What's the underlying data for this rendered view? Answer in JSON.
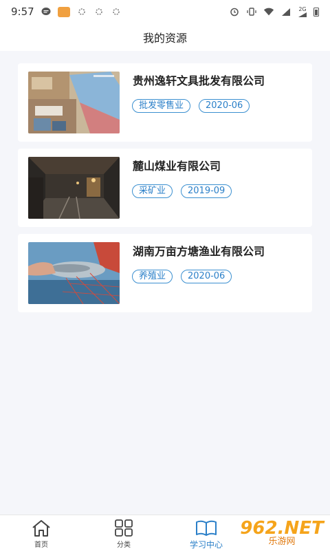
{
  "status_bar": {
    "time": "9:57",
    "network_label": "2G"
  },
  "header": {
    "title": "我的资源"
  },
  "resources": [
    {
      "company": "贵州逸轩文具批发有限公司",
      "tags": [
        "批发零售业",
        "2020-06"
      ]
    },
    {
      "company": "麓山煤业有限公司",
      "tags": [
        "采矿业",
        "2019-09"
      ]
    },
    {
      "company": "湖南万亩方塘渔业有限公司",
      "tags": [
        "养殖业",
        "2020-06"
      ]
    }
  ],
  "bottom_nav": {
    "items": [
      {
        "label": "首页",
        "icon": "home-icon"
      },
      {
        "label": "分类",
        "icon": "grid-icon"
      },
      {
        "label": "学习中心",
        "icon": "book-icon",
        "active": true
      }
    ]
  },
  "watermark": {
    "line1": "962.NET",
    "line2": "乐游网"
  },
  "colors": {
    "accent": "#2a7fc8",
    "background": "#f5f6fa"
  }
}
